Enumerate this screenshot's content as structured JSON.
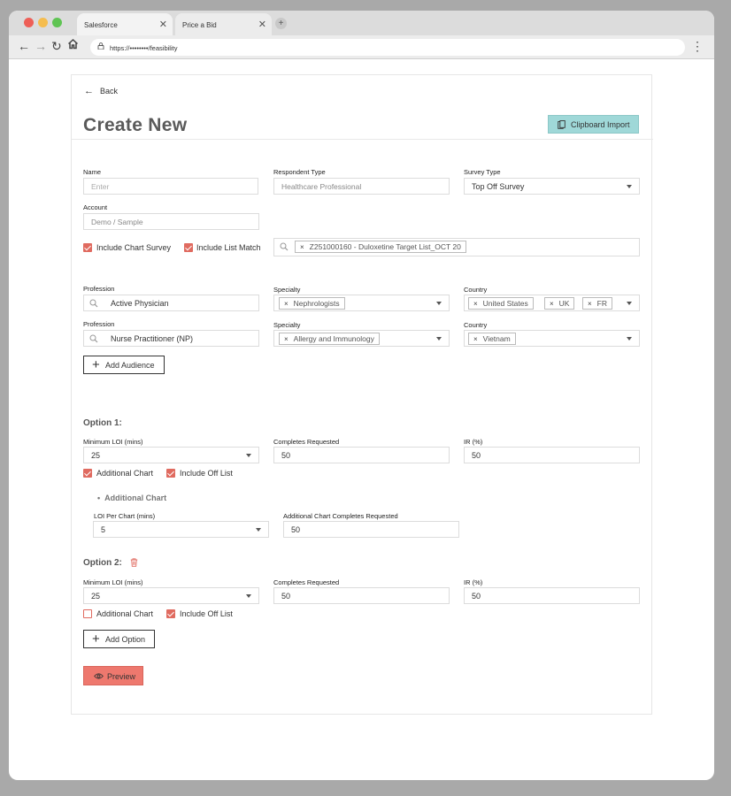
{
  "browser": {
    "tabs": [
      {
        "label": "Salesforce",
        "close": "✕"
      },
      {
        "label": "Price a Bid",
        "close": "✕"
      }
    ],
    "new_tab": "+",
    "url": "https://••••••••/feasibility"
  },
  "colors": {
    "accent_red": "#e06b60",
    "clipboard_bg": "#9fd8d8",
    "preview_bg": "#ee786e"
  },
  "page": {
    "back_label": "Back",
    "title": "Create New",
    "clipboard_import": "Clipboard Import"
  },
  "form": {
    "name": {
      "label": "Name",
      "placeholder": "Enter"
    },
    "respondent_type": {
      "label": "Respondent Type",
      "value": "Healthcare Professional"
    },
    "survey_type": {
      "label": "Survey Type",
      "value": "Top Off Survey"
    },
    "account": {
      "label": "Account",
      "value": "Demo / Sample"
    },
    "include_chart_survey": {
      "label": "Include Chart Survey",
      "checked": true
    },
    "include_list_match": {
      "label": "Include List Match",
      "checked": true
    },
    "list_chip": "Z251000160 - Duloxetine Target List_OCT 20",
    "chip_remove": "×"
  },
  "audiences": [
    {
      "profession_label": "Profession",
      "profession": "Active Physician",
      "specialty_label": "Specialty",
      "specialties": [
        "Nephrologists"
      ],
      "country_label": "Country",
      "countries": [
        "United States",
        "UK",
        "FR"
      ]
    },
    {
      "profession_label": "Profession",
      "profession": "Nurse Practitioner (NP)",
      "specialty_label": "Specialty",
      "specialties": [
        "Allergy and Immunology"
      ],
      "country_label": "Country",
      "countries": [
        "Vietnam"
      ]
    }
  ],
  "add_audience": "Add Audience",
  "options": [
    {
      "title": "Option 1:",
      "min_loi_label": "Minimum LOI (mins)",
      "min_loi": "25",
      "completes_label": "Completes Requested",
      "completes": "50",
      "ir_label": "IR (%)",
      "ir": "50",
      "additional_chart": {
        "label": "Additional Chart",
        "checked": true
      },
      "include_off_list": {
        "label": "Include Off List",
        "checked": true
      },
      "sub": {
        "heading": "Additional Chart",
        "loi_per_chart_label": "LOI Per Chart (mins)",
        "loi_per_chart": "5",
        "chart_completes_label": "Additional Chart Completes Requested",
        "chart_completes": "50"
      }
    },
    {
      "title": "Option 2:",
      "min_loi_label": "Minimum LOI (mins)",
      "min_loi": "25",
      "completes_label": "Completes Requested",
      "completes": "50",
      "ir_label": "IR (%)",
      "ir": "50",
      "additional_chart": {
        "label": "Additional Chart",
        "checked": false
      },
      "include_off_list": {
        "label": "Include Off List",
        "checked": true
      }
    }
  ],
  "add_option": "Add Option",
  "preview": "Preview",
  "bullet": "•"
}
